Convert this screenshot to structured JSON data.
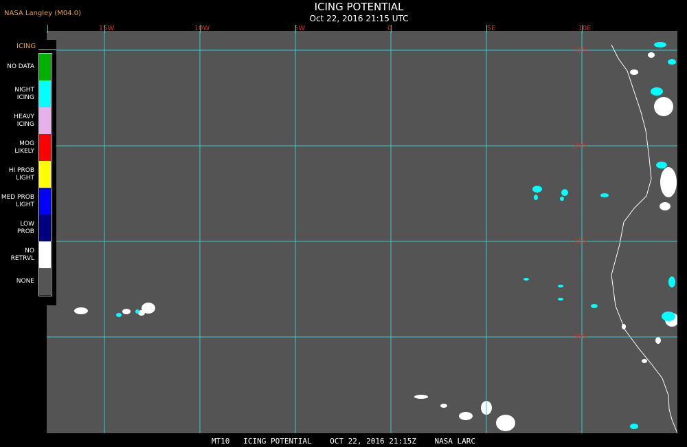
{
  "header": {
    "provider": "NASA Langley (M04.0)",
    "title": "ICING POTENTIAL",
    "subtitle": "Oct 22, 2016 21:15 UTC"
  },
  "map": {
    "background_color": "#545454",
    "gridline_color": "#33cccc",
    "grid_label_color": "#d62a2a",
    "coastline_color": "#ffffff",
    "longitude_labels": [
      "15W",
      "10W",
      "5W",
      "0",
      "5E",
      "10E"
    ],
    "latitude_labels": [
      "15S",
      "20S",
      "25S",
      "30S"
    ]
  },
  "legend": {
    "title": "ICING",
    "items": [
      {
        "label": "NO DATA",
        "color": "#00b000"
      },
      {
        "label": "NIGHT\nICING",
        "color": "#00ffff"
      },
      {
        "label": "HEAVY\nICING",
        "color": "#e8b0e8"
      },
      {
        "label": "MOG\nLIKELY",
        "color": "#ff0000"
      },
      {
        "label": "HI PROB\nLIGHT",
        "color": "#ffff00"
      },
      {
        "label": "MED PROB\nLIGHT",
        "color": "#0000ff"
      },
      {
        "label": "LOW\nPROB",
        "color": "#000080"
      },
      {
        "label": "NO\nRETRVL",
        "color": "#ffffff"
      },
      {
        "label": "NONE",
        "color": "#555555"
      }
    ]
  },
  "footer": {
    "text": "MT10   ICING POTENTIAL    OCT 22, 2016 21:15Z    NASA LARC"
  }
}
